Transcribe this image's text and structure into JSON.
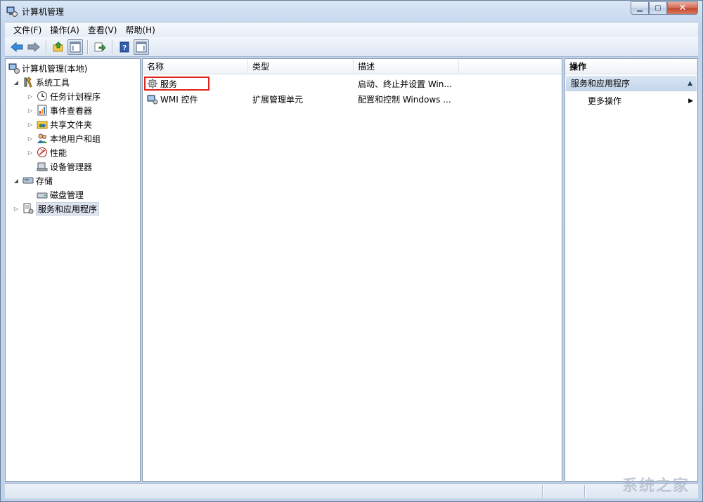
{
  "window": {
    "title": "计算机管理"
  },
  "menu": [
    "文件(F)",
    "操作(A)",
    "查看(V)",
    "帮助(H)"
  ],
  "tree": {
    "root": "计算机管理(本地)",
    "system_tools": "系统工具",
    "task_scheduler": "任务计划程序",
    "event_viewer": "事件查看器",
    "shared_folders": "共享文件夹",
    "local_users": "本地用户和组",
    "performance": "性能",
    "device_manager": "设备管理器",
    "storage": "存储",
    "disk_management": "磁盘管理",
    "services_apps": "服务和应用程序"
  },
  "list": {
    "columns": [
      "名称",
      "类型",
      "描述"
    ],
    "rows": [
      {
        "name": "服务",
        "type": "",
        "desc": "启动、终止并设置 Win..."
      },
      {
        "name": "WMI 控件",
        "type": "扩展管理单元",
        "desc": "配置和控制 Windows ..."
      }
    ]
  },
  "actions": {
    "title": "操作",
    "group": "服务和应用程序",
    "more": "更多操作"
  },
  "watermark": "系统之家",
  "colors": {
    "highlight": "#e0241b",
    "selection": "#dde4ef",
    "action_group": "#c4d5ea"
  }
}
